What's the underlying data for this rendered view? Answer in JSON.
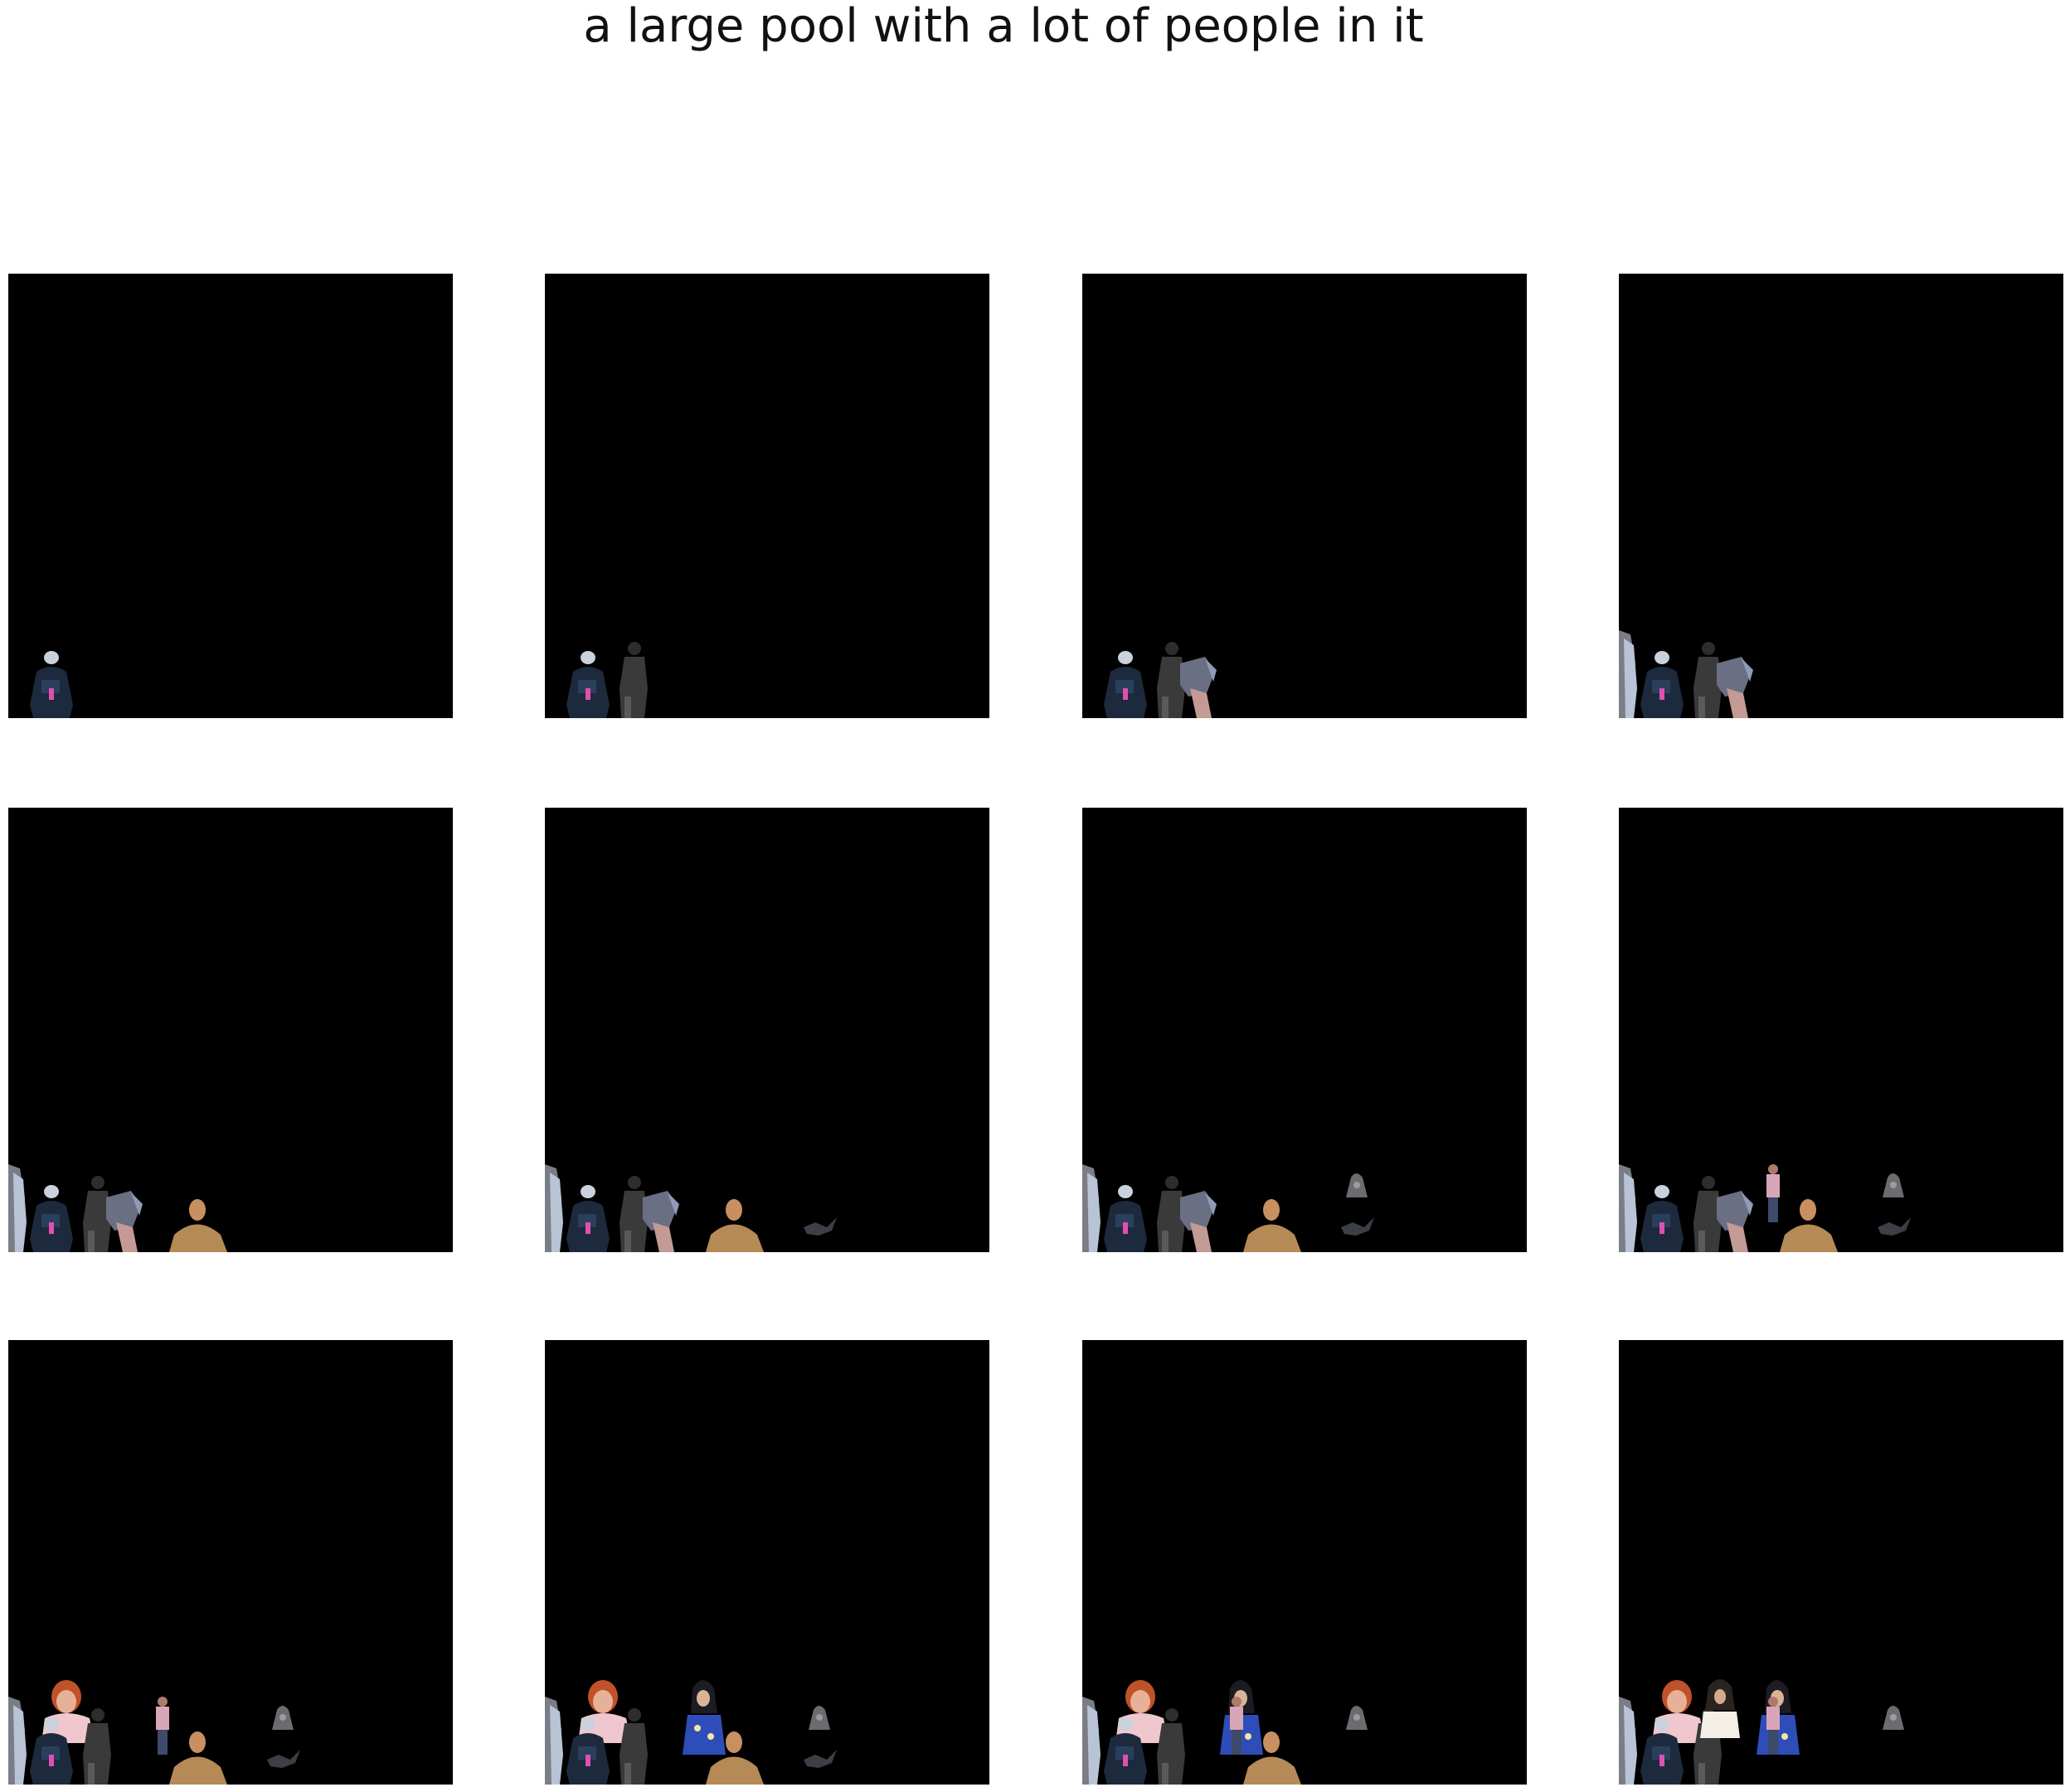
{
  "figure": {
    "title": "a large pool with a lot of people in it"
  },
  "panels": [
    {
      "index": 1,
      "cutouts": [
        "person-dark-jacket"
      ]
    },
    {
      "index": 2,
      "cutouts": [
        "person-dark-jacket",
        "dark-figure"
      ]
    },
    {
      "index": 3,
      "cutouts": [
        "person-dark-jacket",
        "dark-figure",
        "person-shorts"
      ]
    },
    {
      "index": 4,
      "cutouts": [
        "edge-figure",
        "person-dark-jacket",
        "dark-figure",
        "person-shorts"
      ]
    },
    {
      "index": 5,
      "cutouts": [
        "edge-figure",
        "person-dark-jacket",
        "dark-figure",
        "person-shorts",
        "man-tan-shirt"
      ]
    },
    {
      "index": 6,
      "cutouts": [
        "edge-figure",
        "person-dark-jacket",
        "dark-figure",
        "person-shorts",
        "man-tan-shirt",
        "dark-object"
      ]
    },
    {
      "index": 7,
      "cutouts": [
        "edge-figure",
        "person-dark-jacket",
        "dark-figure",
        "person-shorts",
        "man-tan-shirt",
        "dark-object",
        "gray-object"
      ]
    },
    {
      "index": 8,
      "cutouts": [
        "edge-figure",
        "person-dark-jacket",
        "dark-figure",
        "person-shorts",
        "standing-person-pink",
        "man-tan-shirt",
        "dark-object",
        "gray-object"
      ]
    },
    {
      "index": 9,
      "cutouts": [
        "edge-figure",
        "woman-red-hair",
        "person-dark-jacket",
        "dark-figure",
        "standing-person-pink",
        "man-tan-shirt",
        "dark-object",
        "gray-object"
      ]
    },
    {
      "index": 10,
      "cutouts": [
        "edge-figure",
        "woman-red-hair",
        "person-dark-jacket",
        "dark-figure",
        "woman-blue-dress",
        "man-tan-shirt",
        "dark-object",
        "gray-object"
      ]
    },
    {
      "index": 11,
      "cutouts": [
        "edge-figure",
        "woman-red-hair",
        "person-dark-jacket",
        "dark-figure",
        "woman-blue-dress",
        "man-tan-shirt",
        "standing-person-pink",
        "gray-object"
      ]
    },
    {
      "index": 12,
      "cutouts": [
        "edge-figure",
        "woman-red-hair",
        "person-dark-jacket",
        "dark-figure",
        "woman-dark-hair",
        "woman-blue-dress",
        "standing-person-pink",
        "gray-object"
      ]
    }
  ]
}
